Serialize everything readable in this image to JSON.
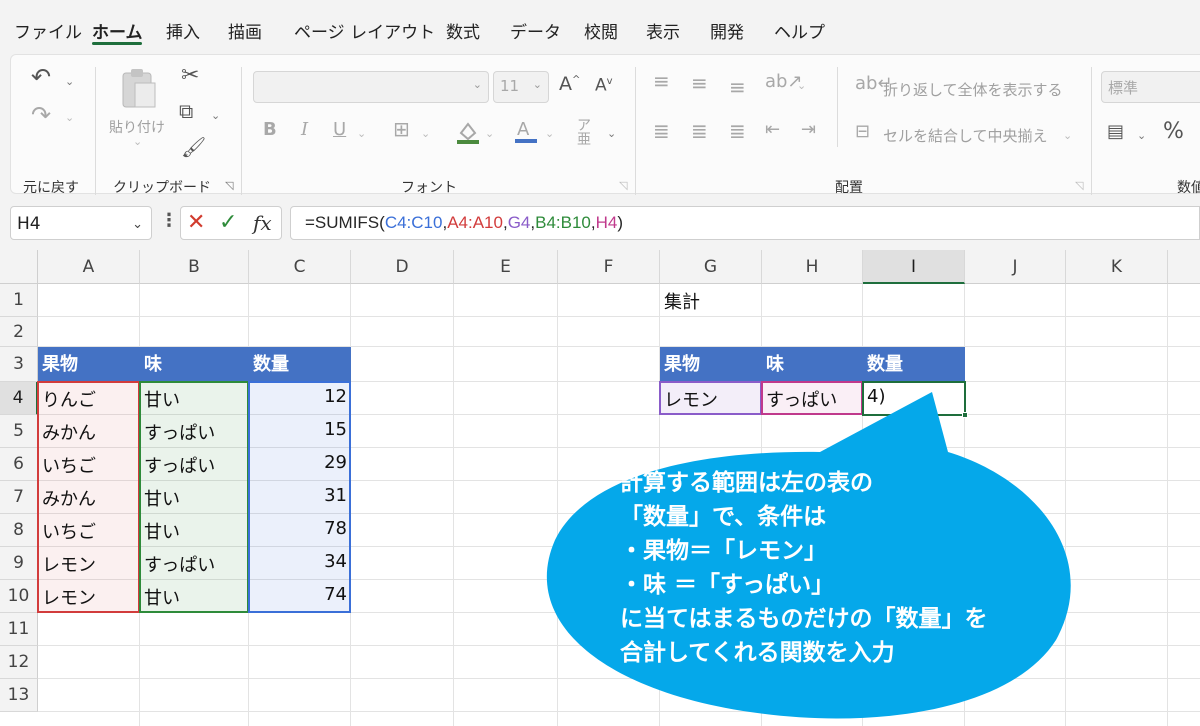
{
  "menu": {
    "tabs": [
      {
        "label": "ファイル",
        "active": false
      },
      {
        "label": "ホーム",
        "active": true
      },
      {
        "label": "挿入",
        "active": false
      },
      {
        "label": "描画",
        "active": false
      },
      {
        "label": "ページ レイアウト",
        "active": false
      },
      {
        "label": "数式",
        "active": false
      },
      {
        "label": "データ",
        "active": false
      },
      {
        "label": "校閲",
        "active": false
      },
      {
        "label": "表示",
        "active": false
      },
      {
        "label": "開発",
        "active": false
      },
      {
        "label": "ヘルプ",
        "active": false
      }
    ]
  },
  "ribbon": {
    "groups": {
      "undo": "元に戻す",
      "clipboard": "クリップボード",
      "font": "フォント",
      "alignment": "配置",
      "number": "数値"
    },
    "paste_label": "貼り付け",
    "font_size": "11",
    "wrap_text": "折り返して全体を表示する",
    "merge_center": "セルを結合して中央揃え",
    "number_format": "標準",
    "bold": "B",
    "italic": "I",
    "underline": "U",
    "percent": "%"
  },
  "formula_bar": {
    "name_box": "H4",
    "fx": "fx",
    "formula_parts": [
      {
        "text": "=SUMIFS(",
        "color": "#262626"
      },
      {
        "text": "C4:C10",
        "color": "#3a6fd8"
      },
      {
        "text": ",",
        "color": "#262626"
      },
      {
        "text": "A4:A10",
        "color": "#d23c3c"
      },
      {
        "text": ",",
        "color": "#262626"
      },
      {
        "text": "G4",
        "color": "#8a5cc9"
      },
      {
        "text": ",",
        "color": "#262626"
      },
      {
        "text": "B4:B10",
        "color": "#2e8b3a"
      },
      {
        "text": ",",
        "color": "#262626"
      },
      {
        "text": "H4",
        "color": "#c0398c"
      },
      {
        "text": ")",
        "color": "#262626"
      }
    ]
  },
  "sheet": {
    "columns": [
      "A",
      "B",
      "C",
      "D",
      "E",
      "F",
      "G",
      "H",
      "I",
      "J",
      "K"
    ],
    "rows": [
      "1",
      "2",
      "3",
      "4",
      "5",
      "6",
      "7",
      "8",
      "9",
      "10",
      "11",
      "12",
      "13"
    ],
    "selected_column": "I",
    "selected_row": "4",
    "summary_title": "集計",
    "table_headers": [
      "果物",
      "味",
      "数量"
    ],
    "table_rows": [
      {
        "fruit": "りんご",
        "taste": "甘い",
        "qty": "12"
      },
      {
        "fruit": "みかん",
        "taste": "すっぱい",
        "qty": "15"
      },
      {
        "fruit": "いちご",
        "taste": "すっぱい",
        "qty": "29"
      },
      {
        "fruit": "みかん",
        "taste": "甘い",
        "qty": "31"
      },
      {
        "fruit": "いちご",
        "taste": "甘い",
        "qty": "78"
      },
      {
        "fruit": "レモン",
        "taste": "すっぱい",
        "qty": "34"
      },
      {
        "fruit": "レモン",
        "taste": "甘い",
        "qty": "74"
      }
    ],
    "summary_headers": [
      "果物",
      "味",
      "数量"
    ],
    "summary_row": {
      "fruit": "レモン",
      "taste": "すっぱい",
      "qty_editing": "4)"
    }
  },
  "colors": {
    "accent": "#1e6e3c",
    "header_fill": "#4472c4",
    "range_fruit": "#d23c3c",
    "range_taste": "#2e8b3a",
    "range_qty": "#3a6fd8",
    "crit_fruit": "#8a5cc9",
    "crit_taste": "#c0398c",
    "callout": "#05a8ea"
  },
  "callout": {
    "lines": [
      "計算する範囲は左の表の",
      "「数量」で、条件は",
      "・果物＝「レモン」",
      "・味 ＝「すっぱい」",
      "に当てはまるものだけの「数量」を",
      "合計してくれる関数を入力"
    ]
  }
}
